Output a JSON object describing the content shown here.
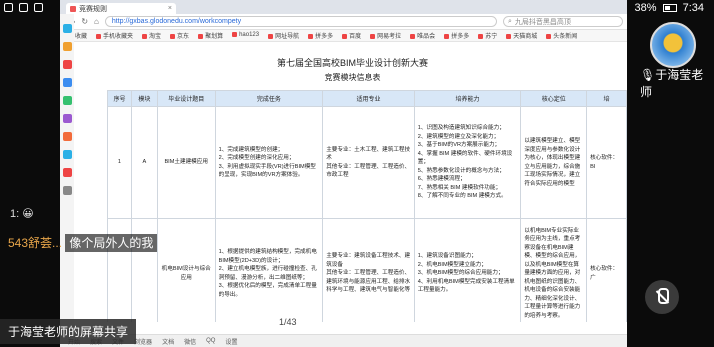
{
  "status_bar": {
    "time": "7:34",
    "battery": "38%"
  },
  "browser": {
    "tab_title": "竞赛规则",
    "url": "http://gxbas.glodonedu.com/workcompety",
    "search_placeholder": "九局抖音黑昌高顶",
    "bookmarks": [
      "收藏",
      "手机收藏夹",
      "淘宝",
      "京东",
      "聚划算",
      "hao123",
      "网址导航",
      "拼多多",
      "百度",
      "网易考拉",
      "唯品会",
      "拼多多",
      "苏宁",
      "天猫商城",
      "头条新闻"
    ]
  },
  "document": {
    "title": "第七届全国高校BIM毕业设计创新大赛",
    "subtitle": "竞赛模块信息表",
    "headers": [
      "序号",
      "模块",
      "毕业设计题目",
      "完成任务",
      "适用专业",
      "培养能力",
      "核心定位",
      "培"
    ],
    "rows": [
      {
        "no": "1",
        "module": "A",
        "topic": "BIM土建建模应用",
        "tasks": "1、完成建筑模型的创建；\n2、完成模型创建的深化应用；\n3、利用虚拟现实手段(VR)进行BIM模型的呈现，实现BIM的VR方案体验。",
        "majors": "主要专业：土木工程、建筑工程技术\n其他专业：工程管理、工程造价、市政工程",
        "abilities": "1、识图及构造建筑知识综合能力；\n2、建筑模型的建立及深化能力；\n3、基于BIM的VR方案展示能力；\n4、掌握 BIM 建模的软件、硬件环境设置；\n5、熟悉参数化设计的概念与方法；\n6、熟悉建模流程；\n7、熟悉相关 BIM 建模软件功能；\n8、了解不同专业的 BIM 建模方式。",
        "core": "以建筑模型建立、模型深度应用与参数化设计为核心，体现出模型建立与应用能力，综合施工现场实际情况，建立符合实际应用的模型",
        "extra": "核心软件：BI"
      },
      {
        "no": "",
        "module": "",
        "topic": "机电BIM设计与综合应用",
        "tasks": "1、根据提供的建筑结构模型，完成机电BIM模型(2D+3D)的设计；\n2、建立机电模型族，进行碰撞检查、孔洞预留、漫游分析，出二维图纸等；\n3、根据优化后的模型，完成清单工程量的导出。",
        "majors": "主要专业：建筑设备工程技术、建筑设备\n其他专业：工程管理、工程造价、建筑环境与能源应用工程、给排水科学与工程、建筑电气与智能化等",
        "abilities": "1、建筑设备识图能力；\n2、机电BIM模型建立能力；\n3、机电BIM模型的综合应用能力；\n4、利用机电BIM模型完成安装工程清单工程量能力。",
        "core": "以机电BIM专业实际业务应用为主线，重点考察设备在机电BIM建模、模型的综合应用，以及机电BIM模型在算量建模方面的应用，对机电图纸的识图能力、机电设备的综合安装能力、精细化深化设计、工程量计算等进行能力的培养与考察。",
        "extra": "核心软件：广"
      }
    ],
    "page_indicator": "1/43"
  },
  "taskbar": [
    "开始",
    "搜索",
    "文件",
    "浏览器",
    "文档",
    "微信",
    "QQ",
    "设置"
  ],
  "chat": {
    "line1": "1: 😀",
    "user": "543舒荟...",
    "message": "像个局外人的我"
  },
  "presenter": {
    "name": "于海莹老师"
  },
  "caption": "于海莹老师的屏幕共享",
  "colors": {
    "header_blue": "#d8e7f7",
    "url_blue": "#2a6ad8",
    "name_orange": "#e8a64a"
  }
}
